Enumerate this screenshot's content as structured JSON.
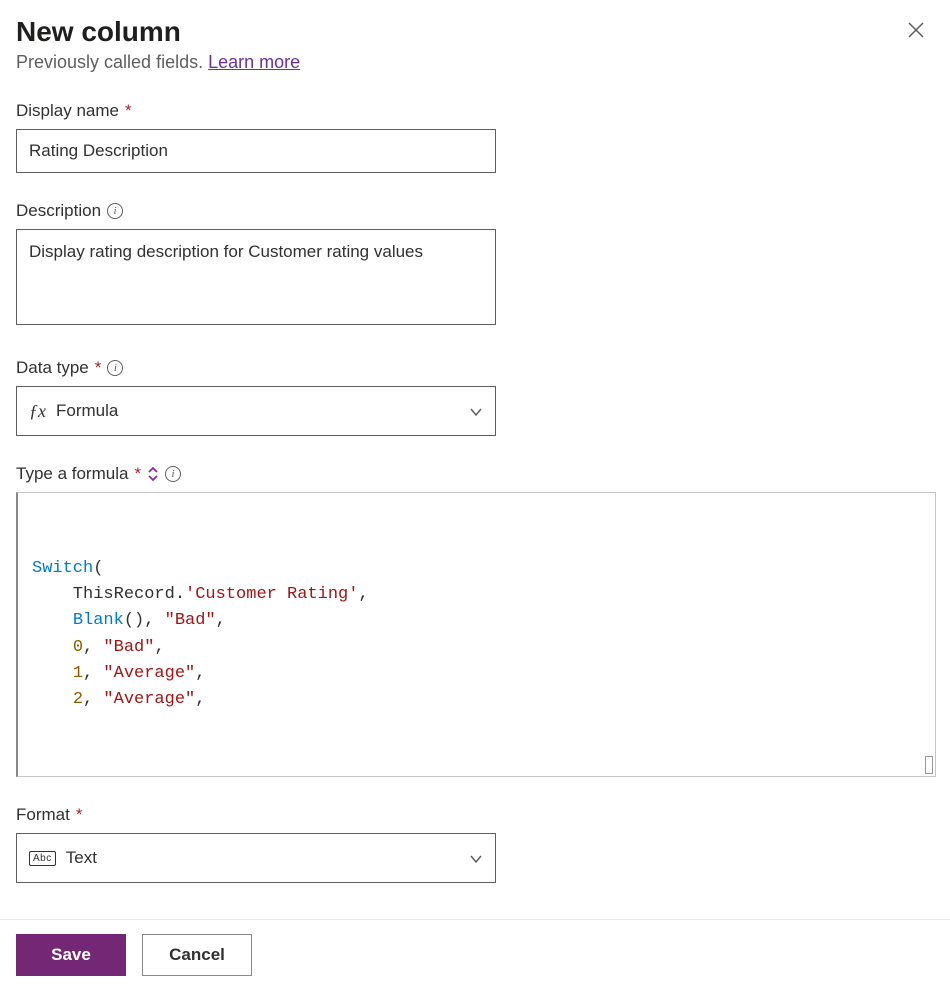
{
  "header": {
    "title": "New column",
    "subtitle_prefix": "Previously called fields. ",
    "learn_more": "Learn more"
  },
  "fields": {
    "display_name": {
      "label": "Display name",
      "value": "Rating Description"
    },
    "description": {
      "label": "Description",
      "value": "Display rating description for Customer rating values"
    },
    "data_type": {
      "label": "Data type",
      "value": "Formula"
    },
    "formula": {
      "label": "Type a formula"
    },
    "format": {
      "label": "Format",
      "value": "Text"
    }
  },
  "formula_tokens": [
    [
      {
        "t": "fn",
        "v": "Switch"
      },
      {
        "t": "txt",
        "v": "("
      }
    ],
    [
      {
        "t": "txt",
        "v": "    ThisRecord."
      },
      {
        "t": "str",
        "v": "'Customer Rating'"
      },
      {
        "t": "txt",
        "v": ","
      }
    ],
    [
      {
        "t": "txt",
        "v": "    "
      },
      {
        "t": "fn",
        "v": "Blank"
      },
      {
        "t": "txt",
        "v": "(), "
      },
      {
        "t": "str",
        "v": "\"Bad\""
      },
      {
        "t": "txt",
        "v": ","
      }
    ],
    [
      {
        "t": "txt",
        "v": "    "
      },
      {
        "t": "num",
        "v": "0"
      },
      {
        "t": "txt",
        "v": ", "
      },
      {
        "t": "str",
        "v": "\"Bad\""
      },
      {
        "t": "txt",
        "v": ","
      }
    ],
    [
      {
        "t": "txt",
        "v": "    "
      },
      {
        "t": "num",
        "v": "1"
      },
      {
        "t": "txt",
        "v": ", "
      },
      {
        "t": "str",
        "v": "\"Average\""
      },
      {
        "t": "txt",
        "v": ","
      }
    ],
    [
      {
        "t": "txt",
        "v": "    "
      },
      {
        "t": "num",
        "v": "2"
      },
      {
        "t": "txt",
        "v": ", "
      },
      {
        "t": "str",
        "v": "\"Average\""
      },
      {
        "t": "txt",
        "v": ","
      }
    ]
  ],
  "buttons": {
    "save": "Save",
    "cancel": "Cancel"
  }
}
